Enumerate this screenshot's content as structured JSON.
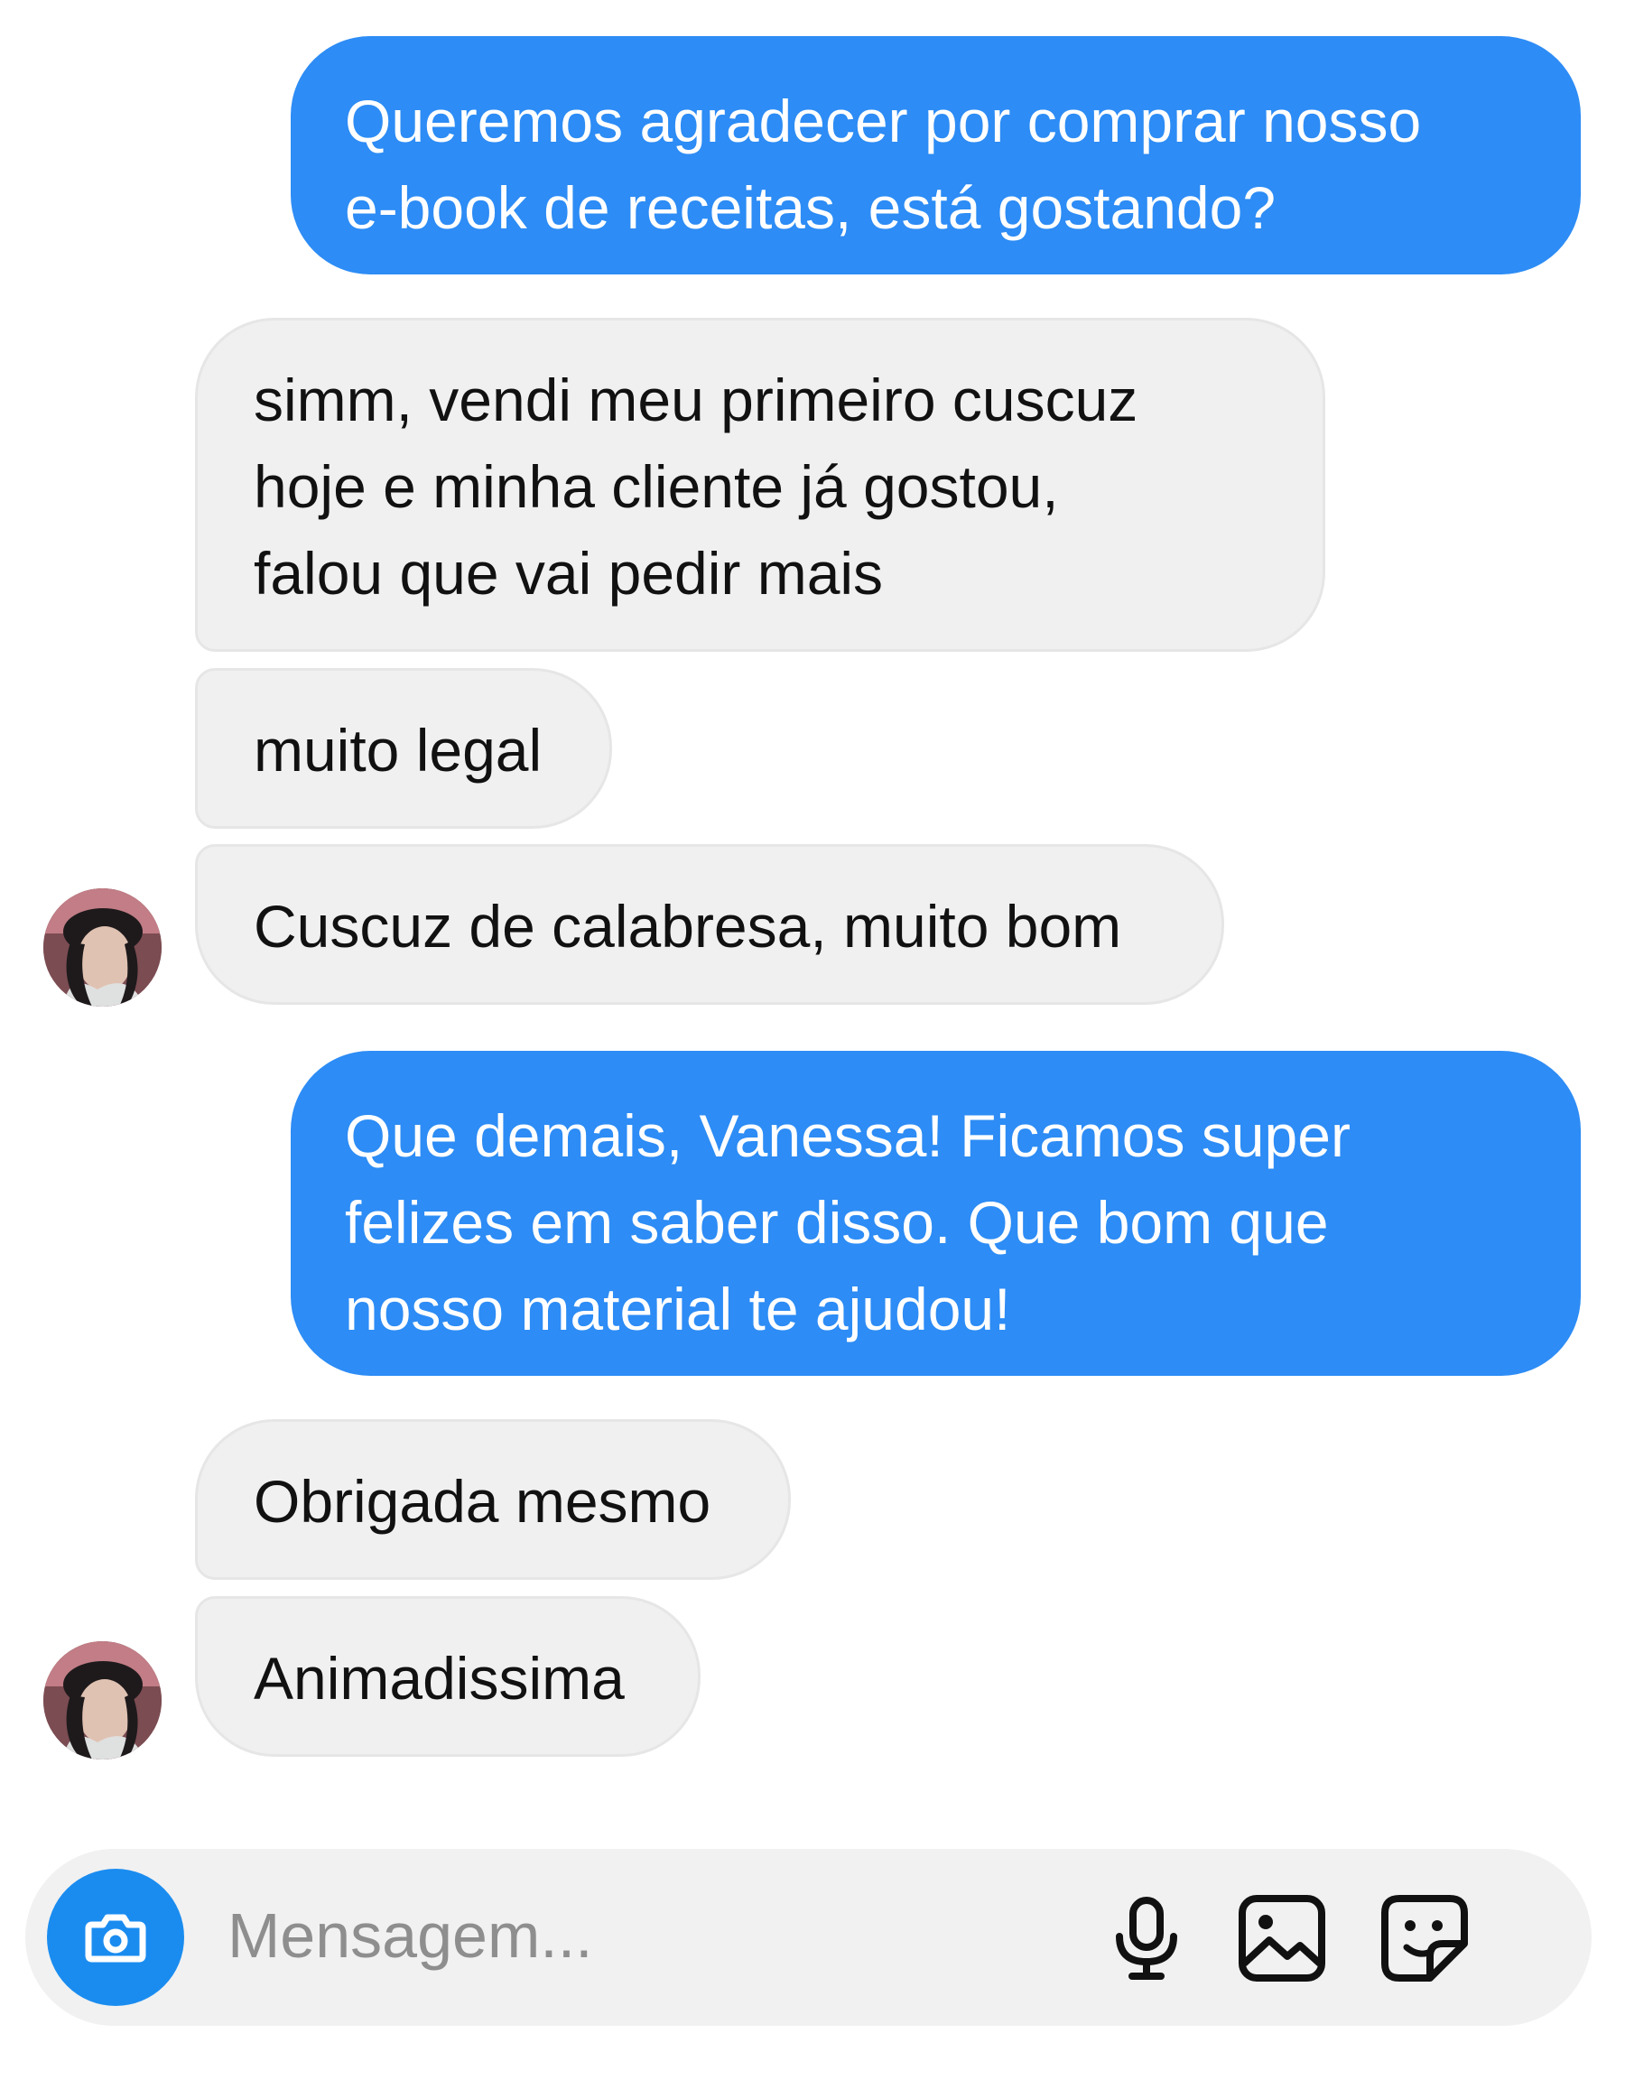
{
  "messages": [
    {
      "direction": "outgoing",
      "lines": [
        "Queremos agradecer por comprar nosso",
        "e-book de receitas, está gostando?"
      ]
    },
    {
      "direction": "incoming",
      "lines": [
        "simm, vendi meu primeiro cuscuz",
        "hoje e minha cliente já gostou,",
        "falou que vai pedir mais"
      ]
    },
    {
      "direction": "incoming",
      "lines": [
        "muito legal"
      ]
    },
    {
      "direction": "incoming",
      "lines": [
        "Cuscuz de calabresa, muito bom"
      ]
    },
    {
      "direction": "outgoing",
      "lines": [
        "Que demais, Vanessa! Ficamos super",
        "felizes em saber disso. Que bom que",
        "nosso material te ajudou!"
      ]
    },
    {
      "direction": "incoming",
      "lines": [
        "Obrigada mesmo"
      ]
    },
    {
      "direction": "incoming",
      "lines": [
        "Animadissima"
      ]
    }
  ],
  "composer": {
    "placeholder": "Mensagem...",
    "value": "",
    "left_button_icon": "camera-icon",
    "right_icons": [
      "microphone-icon",
      "gallery-icon",
      "sticker-icon"
    ]
  },
  "colors": {
    "outgoing_bubble": "#2d8cf5",
    "incoming_bubble": "#f0f0f0",
    "camera_button": "#1a8cf0",
    "composer_background": "#f1f1f1"
  }
}
